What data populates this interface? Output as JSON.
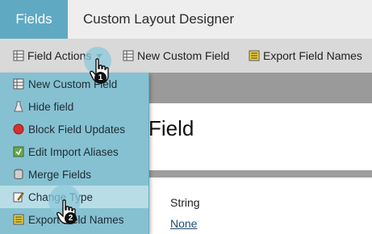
{
  "tabs": {
    "active": "Fields",
    "title": "Custom Layout Designer"
  },
  "toolbar": {
    "field_actions": "Field Actions",
    "new_custom_field": "New Custom Field",
    "export_field_names": "Export Field Names"
  },
  "page": {
    "title": "Field",
    "type_value": "String",
    "none_link": "None"
  },
  "menu": {
    "items": [
      {
        "label": "New Custom Field",
        "icon": "table-icon"
      },
      {
        "label": "Hide field",
        "icon": "flask-icon"
      },
      {
        "label": "Block Field Updates",
        "icon": "block-icon"
      },
      {
        "label": "Edit Import Aliases",
        "icon": "import-icon"
      },
      {
        "label": "Merge Fields",
        "icon": "database-icon"
      },
      {
        "label": "Change Type",
        "icon": "edit-icon"
      },
      {
        "label": "Export Field Names",
        "icon": "export-icon"
      }
    ],
    "highlighted_index": 5
  },
  "cursors": [
    {
      "step": "1"
    },
    {
      "step": "2"
    }
  ],
  "colors": {
    "active_tab": "#5fa9c2",
    "menu_bg": "#86c1d1",
    "menu_highlight": "#b9dde7",
    "toolbar_bg": "#d9d9d9",
    "link": "#1f4d73"
  }
}
